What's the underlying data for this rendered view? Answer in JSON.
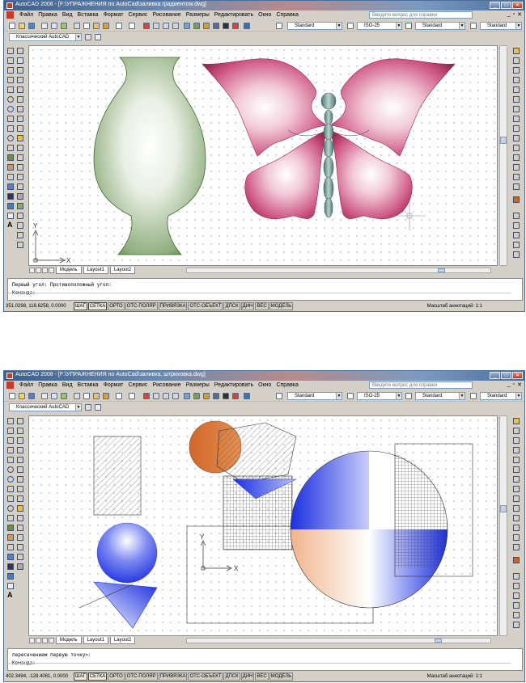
{
  "windows": [
    {
      "title": "AutoCAD 2008 - [F:\\УПРАЖНЕНИЯ по AutoCad\\заливка градиентом.dwg]",
      "menu": [
        "Файл",
        "Правка",
        "Вид",
        "Вставка",
        "Формат",
        "Сервис",
        "Рисование",
        "Размеры",
        "Редактировать",
        "Окно",
        "Справка"
      ],
      "help_placeholder": "Введите вопрос для справки",
      "workspace": "Классический AutoCAD",
      "text_style": "Standard",
      "dim_style": "ISO-25",
      "table_style": "Standard",
      "multileader_style": "Standard",
      "tabs": [
        "Модель",
        "Layout1",
        "Layout2"
      ],
      "command_lines": [
        "Первый угол: Противоположный угол:",
        "Команда:"
      ],
      "coordinates": "351.0298, 118.6258, 0.0000",
      "status_buttons": [
        "ШАГ",
        "СЕТКА",
        "ОРТО",
        "ОТС-ПОЛЯР",
        "ПРИВЯЗКА",
        "ОТС-ОБЪЕКТ",
        "ДПСК",
        "ДИН",
        "ВЕС",
        "МОДЕЛЬ"
      ],
      "annotation_scale": "Масштаб аннотаций:  1:1",
      "ucs_x": "X",
      "ucs_y": "Y",
      "colors": {
        "vase": "#4e7a3b",
        "wings": "#b0305e",
        "body": "#6f9a96"
      }
    },
    {
      "title": "AutoCAD 2008 - [F:\\УПРАЖНЕНИЯ по AutoCad\\заливка, штриховка.dwg]",
      "menu": [
        "Файл",
        "Правка",
        "Вид",
        "Вставка",
        "Формат",
        "Сервис",
        "Рисование",
        "Размеры",
        "Редактировать",
        "Окно",
        "Справка"
      ],
      "help_placeholder": "Введите вопрос для справки",
      "workspace": "Классический AutoCAD",
      "text_style": "Standard",
      "dim_style": "ISO-25",
      "table_style": "Standard",
      "multileader_style": "Standard",
      "tabs": [
        "Модель",
        "Layout1",
        "Layout2"
      ],
      "command_lines": [
        "пересечением первую точку>:",
        "Команда:"
      ],
      "coordinates": "402.3494, -128.4061, 0.0000",
      "status_buttons": [
        "ШАГ",
        "СЕТКА",
        "ОРТО",
        "ОТС-ПОЛЯР",
        "ПРИВЯЗКА",
        "ОТС-ОБЪЕКТ",
        "ДПСК",
        "ДИН",
        "ВЕС",
        "МОДЕЛЬ"
      ],
      "annotation_scale": "Масштаб аннотаций:  1:1",
      "ucs_x": "X",
      "ucs_y": "Y",
      "colors": {
        "blue": "#1a2fe0",
        "orange": "#d0672a",
        "peach": "#f0b48c"
      }
    }
  ]
}
